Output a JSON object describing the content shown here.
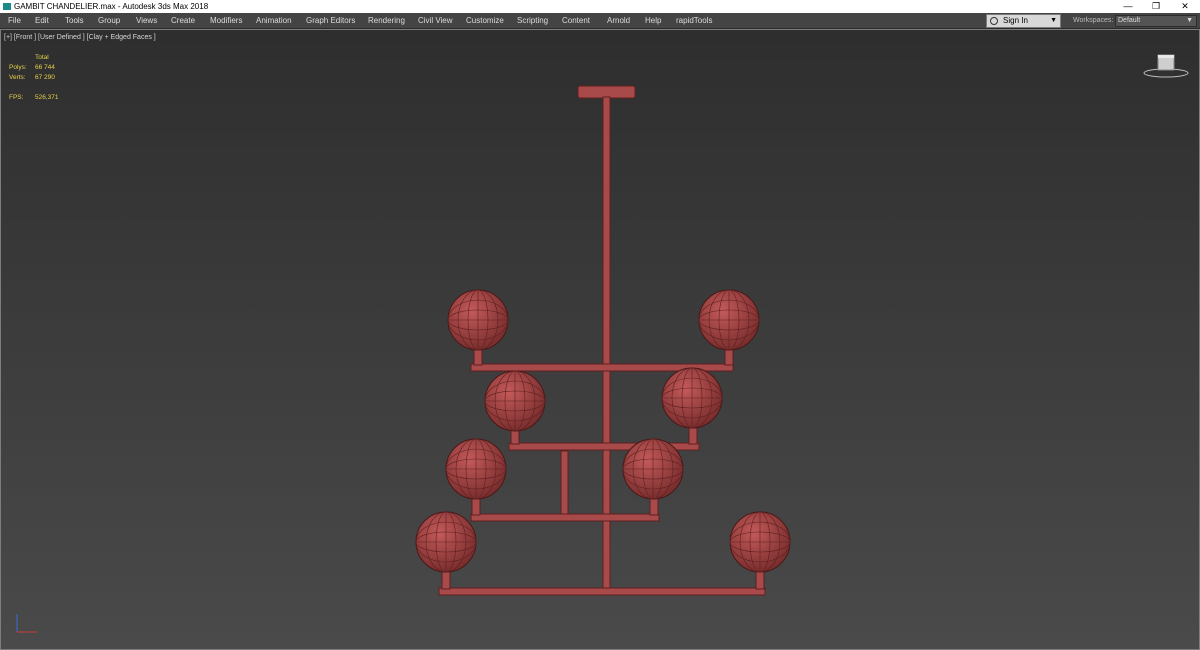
{
  "window": {
    "title": "GAMBIT CHANDELIER.max - Autodesk 3ds Max 2018",
    "controls": {
      "minimize": "—",
      "restore": "❐",
      "close": "✕"
    }
  },
  "menubar": {
    "items": [
      "File",
      "Edit",
      "Tools",
      "Group",
      "Views",
      "Create",
      "Modifiers",
      "Animation",
      "Graph Editors",
      "Rendering",
      "Civil View",
      "Customize",
      "Scripting",
      "Content",
      "Arnold",
      "Help",
      "rapidTools"
    ],
    "signin": "Sign In",
    "workspaces_label": "Workspaces:",
    "workspace_value": "Default"
  },
  "viewport": {
    "label": "[+] [Front ] [User Defined ] [Clay + Edged Faces ]",
    "stats": {
      "header": "Total",
      "polys_label": "Polys:",
      "polys_value": "66 744",
      "verts_label": "Verts:",
      "verts_value": "67 290",
      "fps_label": "FPS:",
      "fps_value": "526,371"
    },
    "model_color": "#a84a4a",
    "wire_color": "#5e1f1f"
  }
}
